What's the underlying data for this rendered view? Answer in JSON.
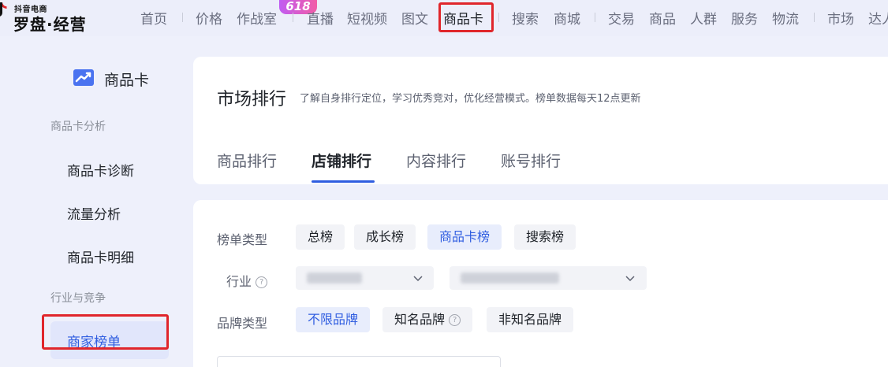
{
  "logo": {
    "sub": "抖音电商",
    "main": "罗盘·经营"
  },
  "topnav": {
    "badge": "618",
    "items": [
      "首页",
      "价格",
      "作战室",
      "直播",
      "短视频",
      "图文",
      "商品卡",
      "搜索",
      "商城",
      "交易",
      "商品",
      "人群",
      "服务",
      "物流",
      "市场",
      "达人"
    ]
  },
  "sidebar": {
    "title": "商品卡",
    "group1": "商品卡分析",
    "items1": [
      "商品卡诊断",
      "流量分析",
      "商品卡明细"
    ],
    "group2": "行业与竞争",
    "active": "商家榜单"
  },
  "header": {
    "title": "市场排行",
    "desc": "了解自身排行定位，学习优秀竞对，优化经营模式。榜单数据每天12点更新",
    "tabs": [
      "商品排行",
      "店铺排行",
      "内容排行",
      "账号排行"
    ],
    "active_tab": "店铺排行"
  },
  "filters": {
    "list_type_label": "榜单类型",
    "list_types": [
      "总榜",
      "成长榜",
      "商品卡榜",
      "搜索榜"
    ],
    "list_type_active": "商品卡榜",
    "industry_label": "行业",
    "brand_label": "品牌类型",
    "brand_types": [
      "不限品牌",
      "知名品牌",
      "非知名品牌"
    ],
    "brand_active": "不限品牌"
  },
  "colors": {
    "accent": "#2f5de0",
    "highlight_box": "#e0262b",
    "page_bg": "#eef0fb"
  }
}
